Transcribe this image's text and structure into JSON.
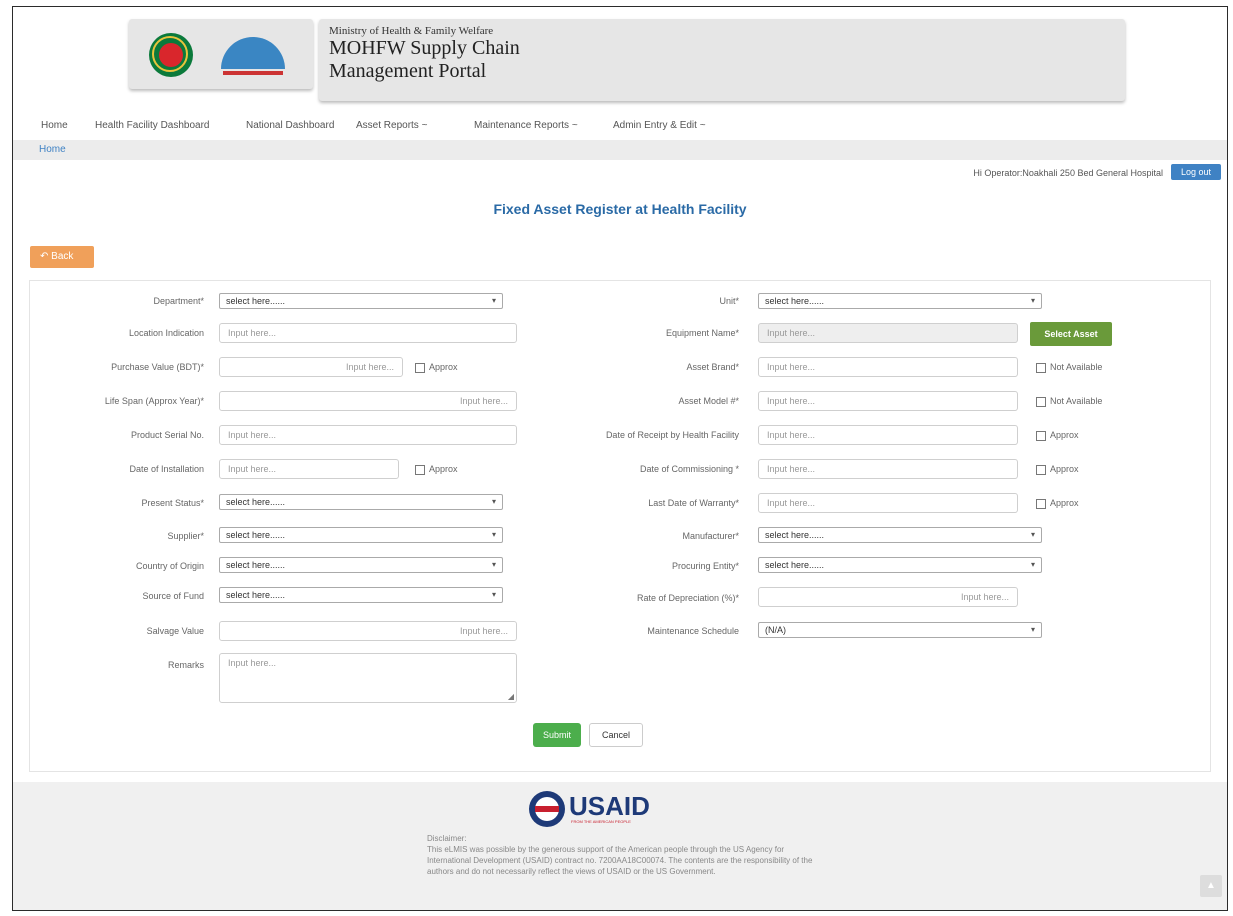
{
  "header": {
    "ministry": "Ministry of Health & Family Welfare",
    "portal_title": "MOHFW Supply Chain Management Portal"
  },
  "nav": {
    "items": [
      "Home",
      "Health Facility Dashboard",
      "National Dashboard",
      "Asset Reports ~",
      "Maintenance Reports ~",
      "Admin Entry & Edit ~"
    ]
  },
  "breadcrumb": {
    "home": "Home"
  },
  "user": {
    "greeting": "Hi Operator:Noakhali 250 Bed General Hospital",
    "logout": "Log out"
  },
  "page": {
    "title": "Fixed Asset Register at Health Facility",
    "back_label": "Back"
  },
  "form": {
    "left": [
      {
        "label": "Department*",
        "type": "select",
        "value": "select here......"
      },
      {
        "label": "Location Indication",
        "type": "input",
        "placeholder": "Input here..."
      },
      {
        "label": "Purchase Value (BDT)*",
        "type": "input",
        "placeholder": "Input here...",
        "check": "Approx"
      },
      {
        "label": "Life Span (Approx Year)*",
        "type": "input",
        "placeholder": "Input here..."
      },
      {
        "label": "Product Serial No.",
        "type": "input",
        "placeholder": "Input here..."
      },
      {
        "label": "Date of Installation",
        "type": "input",
        "placeholder": "Input here...",
        "check": "Approx"
      },
      {
        "label": "Present Status*",
        "type": "select",
        "value": "select here......"
      },
      {
        "label": "Supplier*",
        "type": "select",
        "value": "select here......"
      },
      {
        "label": "Country of Origin",
        "type": "select",
        "value": "select here......"
      },
      {
        "label": "Source of Fund",
        "type": "select",
        "value": "select here......"
      },
      {
        "label": "Salvage Value",
        "type": "input",
        "placeholder": "Input here..."
      },
      {
        "label": "Remarks",
        "type": "textarea",
        "placeholder": "Input here..."
      }
    ],
    "right": [
      {
        "label": "Unit*",
        "type": "select",
        "value": "select here......"
      },
      {
        "label": "Equipment Name*",
        "type": "input",
        "placeholder": "Input here..."
      },
      {
        "label": "Asset Brand*",
        "type": "input",
        "placeholder": "Input here...",
        "check": "Not Available"
      },
      {
        "label": "Asset Model #*",
        "type": "input",
        "placeholder": "Input here...",
        "check": "Not Available"
      },
      {
        "label": "Date of Receipt by Health Facility",
        "type": "input",
        "placeholder": "Input here...",
        "check": "Approx"
      },
      {
        "label": "Date of Commissioning *",
        "type": "input",
        "placeholder": "Input here...",
        "check": "Approx"
      },
      {
        "label": "Last Date of Warranty*",
        "type": "input",
        "placeholder": "Input here...",
        "check": "Approx"
      },
      {
        "label": "Manufacturer*",
        "type": "select",
        "value": "select here......"
      },
      {
        "label": "Procuring Entity*",
        "type": "select",
        "value": "select here......"
      },
      {
        "label": "Rate of Depreciation (%)*",
        "type": "input",
        "placeholder": "Input here..."
      },
      {
        "label": "Maintenance Schedule",
        "type": "select",
        "value": "(N/A)"
      }
    ],
    "select_asset_label": "Select Asset",
    "submit_label": "Submit",
    "cancel_label": "Cancel"
  },
  "footer": {
    "logo_text": "USAID",
    "logo_sub": "FROM THE AMERICAN PEOPLE",
    "disclaimer_title": "Disclaimer:",
    "disclaimer_text": "This eLMIS was possible by the generous support of the American people through the US Agency for International Development (USAID) contract no. 7200AA18C00074. The contents are the responsibility of the authors and do not necessarily reflect the views of USAID or the US Government."
  },
  "colors": {
    "accent": "#2a6aa6",
    "back_button": "#f0a05a",
    "select_asset": "#6a9a3a",
    "submit": "#4cae4c"
  }
}
